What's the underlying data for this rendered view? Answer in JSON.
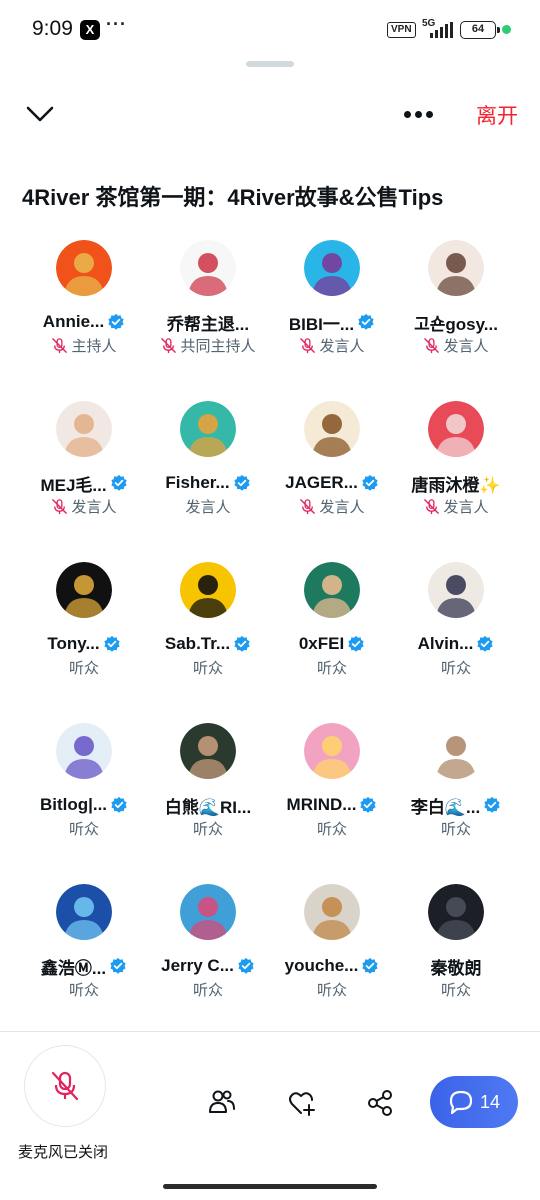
{
  "status_bar": {
    "time": "9:09",
    "app_icon": "X",
    "more": "···",
    "vpn": "VPN",
    "network": "5G",
    "battery": "64"
  },
  "header": {
    "collapse_icon": "chevron-down-icon",
    "more_icon": "more-horizontal-icon",
    "leave_label": "离开",
    "leave_color": "#f4212e"
  },
  "space": {
    "title": "4River 茶馆第一期：4River故事&公售Tips"
  },
  "participants": [
    {
      "name": "Annie...",
      "role": "主持人",
      "verified": true,
      "muted": true,
      "avatar_colors": [
        "#f0521a",
        "#e8b44a"
      ]
    },
    {
      "name": "乔帮主退...",
      "role": "共同主持人",
      "verified": false,
      "muted": true,
      "avatar_colors": [
        "#f7f7f7",
        "#cf3d4d"
      ]
    },
    {
      "name": "BIBI一...",
      "role": "发言人",
      "verified": true,
      "muted": true,
      "avatar_colors": [
        "#2ab5e8",
        "#7a3b9a"
      ]
    },
    {
      "name": "고숀gosy...",
      "role": "发言人",
      "verified": false,
      "muted": true,
      "avatar_colors": [
        "#f3e7e1",
        "#6b4b3e"
      ]
    },
    {
      "name": "MEJ毛...",
      "role": "发言人",
      "verified": true,
      "muted": true,
      "avatar_colors": [
        "#f2e8e3",
        "#e3b08a"
      ]
    },
    {
      "name": "Fisher...",
      "role": "发言人",
      "verified": true,
      "muted": false,
      "avatar_colors": [
        "#35b8a8",
        "#e6a23c"
      ]
    },
    {
      "name": "JAGER...",
      "role": "发言人",
      "verified": true,
      "muted": true,
      "avatar_colors": [
        "#f5ead6",
        "#8a5a2b"
      ]
    },
    {
      "name": "唐雨沐橙✨",
      "role": "发言人",
      "verified": false,
      "muted": true,
      "avatar_colors": [
        "#e94a58",
        "#f2d4d6"
      ]
    },
    {
      "name": "Tony...",
      "role": "听众",
      "verified": true,
      "muted": false,
      "avatar_colors": [
        "#111111",
        "#d9a53a"
      ]
    },
    {
      "name": "Sab.Tr...",
      "role": "听众",
      "verified": true,
      "muted": false,
      "avatar_colors": [
        "#f7c400",
        "#111111"
      ]
    },
    {
      "name": "0xFEI",
      "role": "听众",
      "verified": true,
      "muted": false,
      "avatar_colors": [
        "#1e7a5e",
        "#e6b98f"
      ]
    },
    {
      "name": "Alvin...",
      "role": "听众",
      "verified": true,
      "muted": false,
      "avatar_colors": [
        "#efe9e4",
        "#3a3a55"
      ]
    },
    {
      "name": "Bitlog|...",
      "role": "听众",
      "verified": true,
      "muted": false,
      "avatar_colors": [
        "#e3eef7",
        "#6a5ac8"
      ]
    },
    {
      "name": "白熊🌊RI...",
      "role": "听众",
      "verified": false,
      "muted": false,
      "avatar_colors": [
        "#2b3a2f",
        "#c49a7a"
      ]
    },
    {
      "name": "MRIND...",
      "role": "听众",
      "verified": true,
      "muted": false,
      "avatar_colors": [
        "#f2a3c2",
        "#ffd36b"
      ]
    },
    {
      "name": "李白🌊...",
      "role": "听众",
      "verified": true,
      "muted": false,
      "avatar_colors": [
        "#ffffff",
        "#b08a6a"
      ]
    },
    {
      "name": "鑫浩Ⓜ...",
      "role": "听众",
      "verified": true,
      "muted": false,
      "avatar_colors": [
        "#1b4fa8",
        "#6fc3f0"
      ]
    },
    {
      "name": "Jerry C...",
      "role": "听众",
      "verified": true,
      "muted": false,
      "avatar_colors": [
        "#3fa0d8",
        "#d84a7a"
      ]
    },
    {
      "name": "youche...",
      "role": "听众",
      "verified": true,
      "muted": false,
      "avatar_colors": [
        "#d9d3ca",
        "#c28a4a"
      ]
    },
    {
      "name": "秦敬朗",
      "role": "听众",
      "verified": false,
      "muted": false,
      "avatar_colors": [
        "#1c1f26",
        "#4a4f5a"
      ]
    }
  ],
  "bottom_bar": {
    "mic_label": "麦克风已关闭",
    "mic_icon": "mic-off-icon",
    "people_icon": "people-icon",
    "heart_icon": "heart-plus-icon",
    "share_icon": "share-icon",
    "comments_icon": "chat-bubble-icon",
    "comments_count": "14",
    "accent": "#4a6ff0",
    "verified_color": "#1d9bf0",
    "muted_color": "#e0245e"
  }
}
